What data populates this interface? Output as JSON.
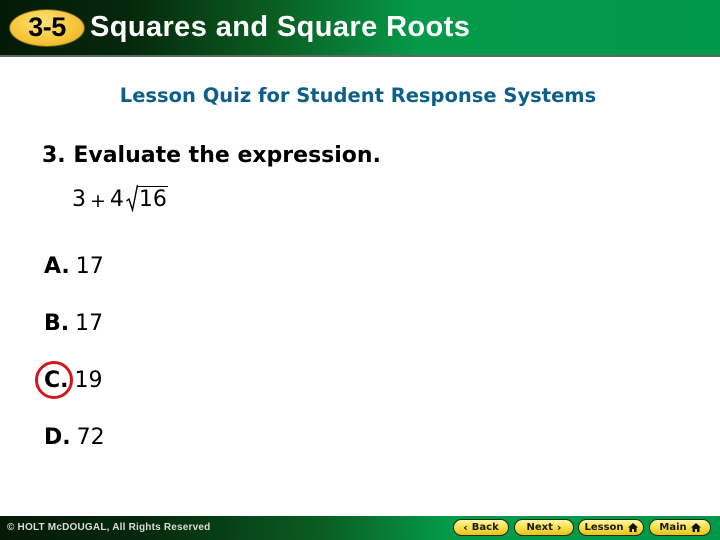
{
  "header": {
    "lesson_number": "3-5",
    "title": "Squares and Square Roots"
  },
  "subtitle": "Lesson Quiz for Student Response Systems",
  "question": {
    "label": "3. Evaluate the expression.",
    "expression": {
      "term1": "3",
      "operator": "+",
      "coefficient": "4",
      "radicand": "16"
    }
  },
  "options": [
    {
      "letter": "A.",
      "value": "17",
      "selected": false
    },
    {
      "letter": "B.",
      "value": "17",
      "selected": false
    },
    {
      "letter": "C.",
      "value": "19",
      "selected": true
    },
    {
      "letter": "D.",
      "value": "72",
      "selected": false
    }
  ],
  "colors": {
    "subtitle": "#0d5f8a",
    "selection_circle": "#d5161b",
    "badge": "#f6c63a",
    "header_green": "#00984b"
  },
  "footer": {
    "copyright": "© HOLT McDOUGAL, All Rights Reserved",
    "nav": {
      "back_label": "Back",
      "next_label": "Next",
      "lesson_label": "Lesson",
      "main_label": "Main"
    }
  }
}
